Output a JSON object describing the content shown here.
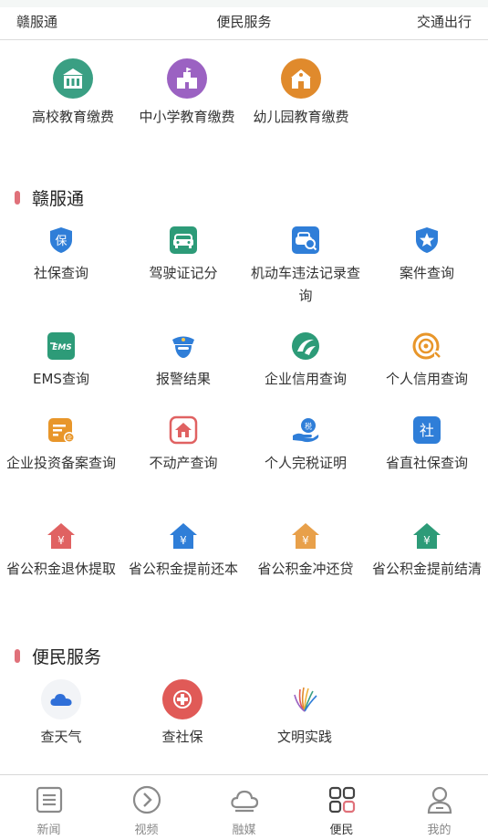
{
  "top_nav": [
    "赣服通",
    "便民服务",
    "交通出行"
  ],
  "education": [
    {
      "label": "高校教育缴费",
      "icon": "university-icon",
      "color": "#3a9f83"
    },
    {
      "label": "中小学教育缴费",
      "icon": "school-icon",
      "color": "#9b62c2"
    },
    {
      "label": "幼儿园教育缴费",
      "icon": "kindergarten-icon",
      "color": "#e08a2c"
    }
  ],
  "ganfutong": {
    "title": "赣服通",
    "items": [
      {
        "label": "社保查询",
        "icon": "social-security-shield-icon",
        "color": "#2f7ed8"
      },
      {
        "label": "驾驶证记分",
        "icon": "car-icon",
        "color": "#2d9b78"
      },
      {
        "label": "机动车违法记录查询",
        "icon": "car-search-icon",
        "color": "#2f7ed8"
      },
      {
        "label": "案件查询",
        "icon": "police-badge-icon",
        "color": "#2f7ed8"
      },
      {
        "label": "EMS查询",
        "icon": "ems-icon",
        "color": "#2d9b78"
      },
      {
        "label": "报警结果",
        "icon": "police-officer-icon",
        "color": "#2f7ed8"
      },
      {
        "label": "企业信用查询",
        "icon": "enterprise-credit-icon",
        "color": "#2d9b78"
      },
      {
        "label": "个人信用查询",
        "icon": "personal-credit-icon",
        "color": "#e8962a"
      },
      {
        "label": "企业投资备案查询",
        "icon": "enterprise-filing-icon",
        "color": "#e8962a"
      },
      {
        "label": "不动产查询",
        "icon": "real-estate-icon",
        "color": "#e06262"
      },
      {
        "label": "个人完税证明",
        "icon": "tax-icon",
        "color": "#2f7ed8"
      },
      {
        "label": "省直社保查询",
        "icon": "provincial-social-security-icon",
        "color": "#2f7ed8"
      },
      {
        "label": "省公积金退休提取",
        "icon": "housing-fund-retire-icon",
        "color": "#e06262"
      },
      {
        "label": "省公积金提前还本",
        "icon": "housing-fund-repay-icon",
        "color": "#2f7ed8"
      },
      {
        "label": "省公积金冲还贷",
        "icon": "housing-fund-offset-icon",
        "color": "#e8a04a"
      },
      {
        "label": "省公积金提前结清",
        "icon": "housing-fund-settle-icon",
        "color": "#2d9b78"
      }
    ]
  },
  "bianmin": {
    "title": "便民服务",
    "items": [
      {
        "label": "查天气",
        "icon": "weather-cloud-icon",
        "color": "#2f6fd8"
      },
      {
        "label": "查社保",
        "icon": "social-insurance-icon",
        "color": "#e05a57"
      },
      {
        "label": "文明实践",
        "icon": "civilization-practice-icon",
        "color": "#e08a2c"
      }
    ]
  },
  "tabbar": [
    {
      "label": "新闻",
      "icon": "news-icon",
      "active": false
    },
    {
      "label": "视频",
      "icon": "video-icon",
      "active": false
    },
    {
      "label": "融媒",
      "icon": "cloud-icon",
      "active": false
    },
    {
      "label": "便民",
      "icon": "grid-icon",
      "active": true
    },
    {
      "label": "我的",
      "icon": "user-icon",
      "active": false
    }
  ],
  "colors": {
    "accent_bar": "#e0717a",
    "tab_active": "#333333",
    "tab_inactive": "#888888"
  }
}
